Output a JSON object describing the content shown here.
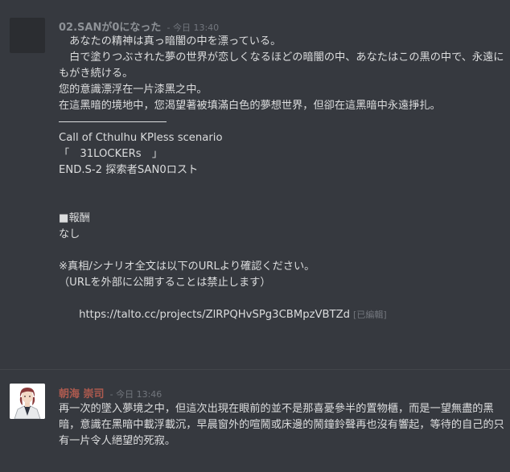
{
  "message1": {
    "username": "02.SANが0になった",
    "username_color": "#8e9297",
    "timestamp": "- 今日 13:40",
    "lines": [
      "　あなたの精神は真っ暗闇の中を漂っている。",
      "　白で塗りつぶされた夢の世界が恋しくなるほどの暗闇の中、あなたはこの黒の中で、永遠にもがき続ける。",
      "您的意識漂浮在一片漆黑之中。",
      "在這黑暗的境地中，您渴望著被填滿白色的夢想世界，但卻在這黑暗中永遠掙扎。",
      "Call of Cthulhu KPless scenario",
      "「　31LOCKERs　」",
      "END.S-2 探索者SAN0ロスト",
      "■報酬",
      "なし",
      "※真相/シナリオ全文は以下のURLより確認ください。",
      "（URLを外部に公開することは禁止します）",
      "https://talto.cc/projects/ZlRPQHvSPg3CBMpzVBTZd"
    ],
    "edited_label": "[已編輯]"
  },
  "message2": {
    "username": "朝海 崇司",
    "username_color": "#ad5a4f",
    "timestamp": "- 今日 13:46",
    "text": "再一次的墜入夢境之中，但這次出現在眼前的並不是那喜憂參半的置物櫃，而是一望無盡的黑暗，意識在黑暗中載浮載沉，早晨窗外的喧鬧或床邊的鬧鐘鈴聲再也沒有響起，等待的自己的只有一片令人絕望的死寂。"
  }
}
